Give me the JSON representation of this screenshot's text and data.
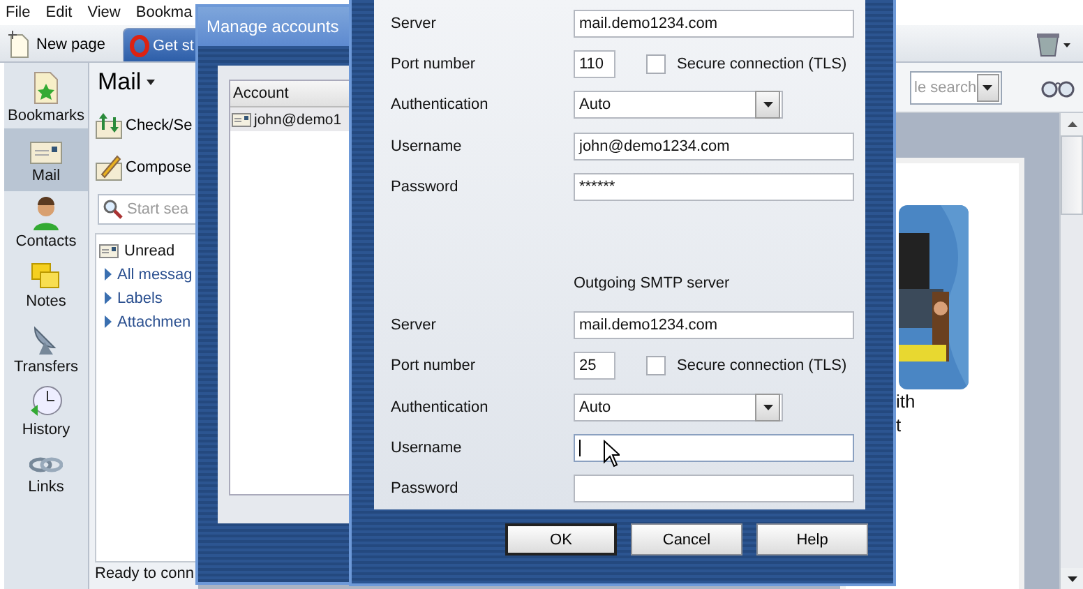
{
  "menu": [
    "File",
    "Edit",
    "View",
    "Bookma"
  ],
  "new_page_button": "New page",
  "tabs": [
    {
      "label": "Get st",
      "selected": true
    }
  ],
  "sidebar": {
    "items": [
      {
        "label": "Bookmarks",
        "kind": "bookmarks",
        "selected": false
      },
      {
        "label": "Mail",
        "kind": "mail",
        "selected": true
      },
      {
        "label": "Contacts",
        "kind": "contacts",
        "selected": false
      },
      {
        "label": "Notes",
        "kind": "notes",
        "selected": false
      },
      {
        "label": "Transfers",
        "kind": "transfers",
        "selected": false
      },
      {
        "label": "History",
        "kind": "history",
        "selected": false
      },
      {
        "label": "Links",
        "kind": "links",
        "selected": false
      }
    ]
  },
  "mail_panel": {
    "title": "Mail",
    "actions": [
      {
        "label": "Check/Se",
        "kind": "check"
      },
      {
        "label": "Compose",
        "kind": "compose"
      }
    ],
    "search": {
      "placeholder": "Start sea"
    },
    "tree": [
      {
        "label": "Unread",
        "kind": "mail"
      },
      {
        "label": "All messag",
        "kind": "folder"
      },
      {
        "label": "Labels",
        "kind": "folder"
      },
      {
        "label": "Attachmen",
        "kind": "folder"
      }
    ],
    "status": "Ready to conn"
  },
  "search_field": {
    "placeholder": "le search"
  },
  "page": {
    "lines": [
      "ith",
      "t"
    ]
  },
  "accounts_dialog": {
    "title": "Manage accounts",
    "column": "Account",
    "rows": [
      "john@demo1"
    ]
  },
  "properties_dialog": {
    "incoming": [
      {
        "label": "Server",
        "kind": "text",
        "value": "mail.demo1234.com"
      },
      {
        "label": "Port number",
        "kind": "port",
        "value": "110",
        "tls": {
          "label": "Secure connection (TLS)",
          "checked": false
        }
      },
      {
        "label": "Authentication",
        "kind": "select",
        "value": "Auto"
      },
      {
        "label": "Username",
        "kind": "text",
        "value": "john@demo1234.com"
      },
      {
        "label": "Password",
        "kind": "text",
        "value": "******"
      }
    ],
    "outgoing_title": "Outgoing SMTP server",
    "outgoing": [
      {
        "label": "Server",
        "kind": "text",
        "value": "mail.demo1234.com"
      },
      {
        "label": "Port number",
        "kind": "port",
        "value": "25",
        "tls": {
          "label": "Secure connection (TLS)",
          "checked": false
        }
      },
      {
        "label": "Authentication",
        "kind": "select",
        "value": "Auto"
      },
      {
        "label": "Username",
        "kind": "text",
        "focused": true
      },
      {
        "label": "Password",
        "kind": "text"
      }
    ],
    "buttons": [
      {
        "label": "OK",
        "default": true
      },
      {
        "label": "Cancel",
        "default": false
      },
      {
        "label": "Help",
        "default": false
      }
    ]
  }
}
